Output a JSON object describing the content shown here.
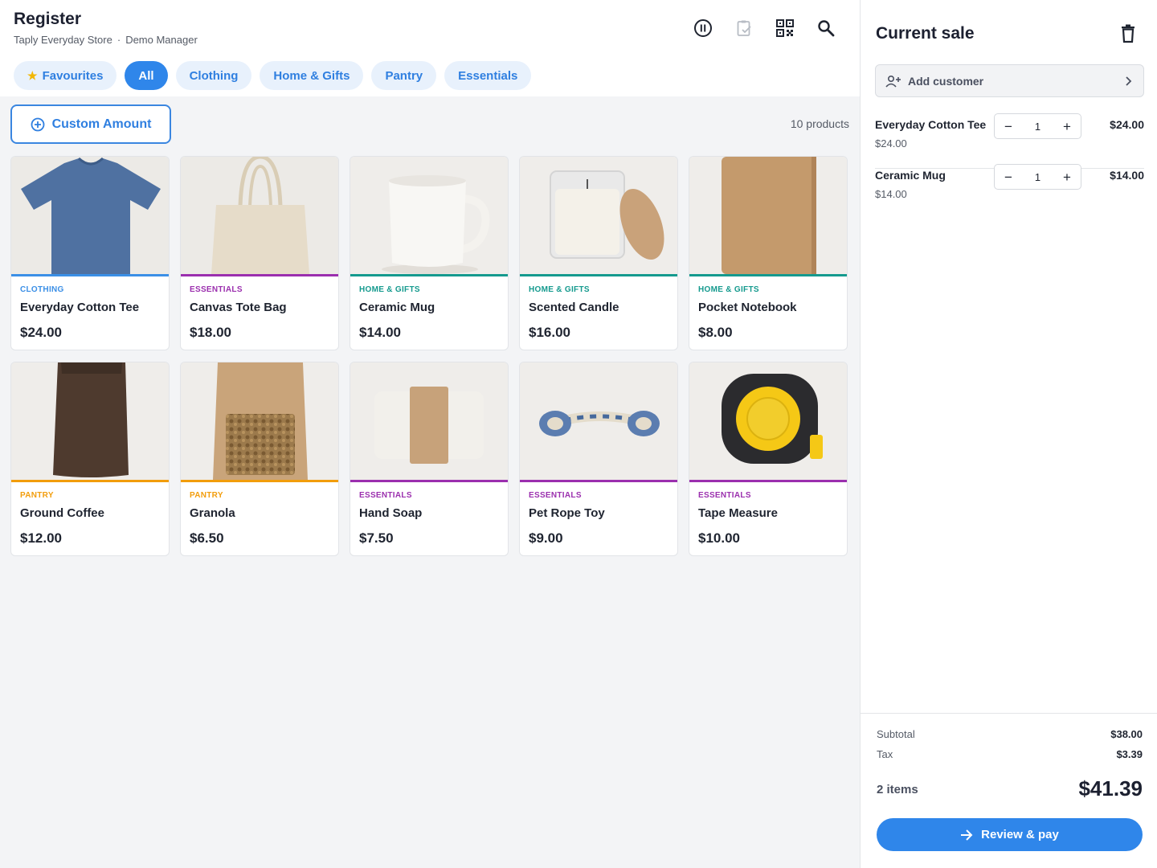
{
  "header": {
    "title": "Register",
    "store": "Taply Everyday Store",
    "separator": "·",
    "manager": "Demo Manager",
    "icons": [
      "pause-icon",
      "clipboard-check-icon",
      "qr-code-icon",
      "search-icon"
    ]
  },
  "categories": [
    {
      "label": "Favourites",
      "active": false,
      "icon": "star-icon"
    },
    {
      "label": "All",
      "active": true
    },
    {
      "label": "Clothing",
      "active": false
    },
    {
      "label": "Home & Gifts",
      "active": false
    },
    {
      "label": "Pantry",
      "active": false
    },
    {
      "label": "Essentials",
      "active": false
    }
  ],
  "toolbar": {
    "custom_amount_label": "Custom Amount",
    "product_count": "10 products"
  },
  "colors": {
    "accent": "#2f86ea",
    "clothing": "#3b8fe6",
    "essentials": "#9b2fae",
    "home_gifts": "#159a8e",
    "pantry": "#f29d0c"
  },
  "products": [
    {
      "category": "CLOTHING",
      "name": "Everyday Cotton Tee",
      "price": "$24.00"
    },
    {
      "category": "ESSENTIALS",
      "name": "Canvas Tote Bag",
      "price": "$18.00"
    },
    {
      "category": "HOME & GIFTS",
      "name": "Ceramic Mug",
      "price": "$14.00"
    },
    {
      "category": "HOME & GIFTS",
      "name": "Scented Candle",
      "price": "$16.00"
    },
    {
      "category": "HOME & GIFTS",
      "name": "Pocket Notebook",
      "price": "$8.00"
    },
    {
      "category": "PANTRY",
      "name": "Ground Coffee",
      "price": "$12.00"
    },
    {
      "category": "PANTRY",
      "name": "Granola",
      "price": "$6.50"
    },
    {
      "category": "ESSENTIALS",
      "name": "Hand Soap",
      "price": "$7.50"
    },
    {
      "category": "ESSENTIALS",
      "name": "Pet Rope Toy",
      "price": "$9.00"
    },
    {
      "category": "ESSENTIALS",
      "name": "Tape Measure",
      "price": "$10.00"
    }
  ],
  "sale": {
    "title": "Current sale",
    "add_customer_label": "Add customer",
    "lines": [
      {
        "name": "Everyday Cotton Tee",
        "unit_price": "$24.00",
        "qty": "1",
        "total": "$24.00",
        "minus": "−",
        "plus": "+"
      },
      {
        "name": "Ceramic Mug",
        "unit_price": "$14.00",
        "qty": "1",
        "total": "$14.00",
        "minus": "−",
        "plus": "+"
      }
    ],
    "subtotal_label": "Subtotal",
    "subtotal": "$38.00",
    "tax_label": "Tax",
    "tax": "$3.39",
    "items_count": "2 items",
    "total": "$41.39",
    "pay_label": "Review & pay"
  }
}
